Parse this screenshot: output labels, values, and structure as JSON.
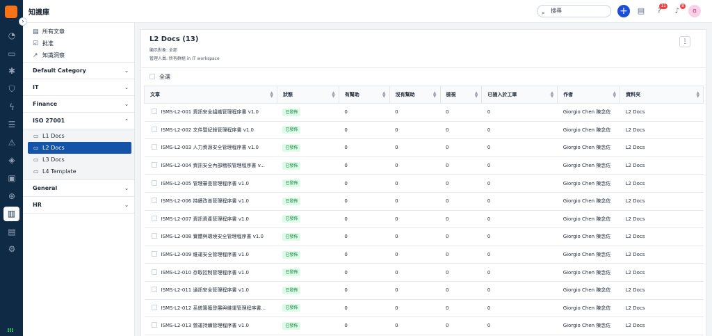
{
  "app": {
    "title": "知識庫"
  },
  "search": {
    "placeholder": "搜尋"
  },
  "header_badges": {
    "help": "11",
    "notifications": "8"
  },
  "avatar": {
    "initials": "G"
  },
  "rail": [
    {
      "name": "dashboard-icon",
      "glyph": "◔"
    },
    {
      "name": "inbox-icon",
      "glyph": "▭"
    },
    {
      "name": "bug-icon",
      "glyph": "✱"
    },
    {
      "name": "shield-icon",
      "glyph": "⛉"
    },
    {
      "name": "bolt-icon",
      "glyph": "ϟ"
    },
    {
      "name": "list-icon",
      "glyph": "☰"
    },
    {
      "name": "warning-icon",
      "glyph": "⚠"
    },
    {
      "name": "layers-icon",
      "glyph": "◈"
    },
    {
      "name": "contacts-icon",
      "glyph": "▣"
    },
    {
      "name": "compass-icon",
      "glyph": "⊕"
    },
    {
      "name": "book-icon",
      "glyph": "▥"
    },
    {
      "name": "chart-icon",
      "glyph": "▤"
    },
    {
      "name": "settings-icon",
      "glyph": "⚙"
    }
  ],
  "sidebar": {
    "links": [
      {
        "label": "所有文章",
        "icon": "▤"
      },
      {
        "label": "批准",
        "icon": "☑"
      },
      {
        "label": "知識洞察",
        "icon": "↗"
      }
    ],
    "categories": [
      {
        "label": "Default Category",
        "open": false,
        "children": []
      },
      {
        "label": "IT",
        "open": false,
        "children": []
      },
      {
        "label": "Finance",
        "open": false,
        "children": []
      },
      {
        "label": "ISO 27001",
        "open": true,
        "children": [
          {
            "label": "L1 Docs",
            "selected": false
          },
          {
            "label": "L2 Docs",
            "selected": true
          },
          {
            "label": "L3 Docs",
            "selected": false
          },
          {
            "label": "L4 Template",
            "selected": false
          }
        ]
      },
      {
        "label": "General",
        "open": false,
        "children": []
      },
      {
        "label": "HR",
        "open": false,
        "children": []
      }
    ]
  },
  "main": {
    "title": "L2 Docs (13)",
    "visibility": "顯示對象: 全部",
    "admin": "管理人員: 所有群組 in IT workspace",
    "select_all": "全選"
  },
  "table": {
    "columns": [
      "文章",
      "狀態",
      "有幫助",
      "沒有幫助",
      "檢視",
      "已插入於工單",
      "作者",
      "資料夾"
    ],
    "column_widths": [
      191,
      89,
      73,
      73,
      60,
      109,
      90,
      120
    ],
    "rows": [
      [
        "ISMS-L2-001 資訊安全組織管理程序書 v1.0",
        "已發佈",
        "0",
        "0",
        "0",
        "0",
        "Giorgio Chen 陳念佐",
        "L2 Docs"
      ],
      [
        "ISMS-L2-002 文件暨紀錄管理程序書 v1.0",
        "已發佈",
        "0",
        "0",
        "0",
        "0",
        "Giorgio Chen 陳念佐",
        "L2 Docs"
      ],
      [
        "ISMS-L2-003 人力資源安全管理程序書 v1.0",
        "已發佈",
        "0",
        "0",
        "0",
        "0",
        "Giorgio Chen 陳念佐",
        "L2 Docs"
      ],
      [
        "ISMS-L2-004 資訊安全內部稽核管理程序書 v...",
        "已發佈",
        "0",
        "0",
        "0",
        "0",
        "Giorgio Chen 陳念佐",
        "L2 Docs"
      ],
      [
        "ISMS-L2-005 管理審查管理程序書 v1.0",
        "已發佈",
        "0",
        "0",
        "0",
        "0",
        "Giorgio Chen 陳念佐",
        "L2 Docs"
      ],
      [
        "ISMS-L2-006 持續改善管理程序書 v1.0",
        "已發佈",
        "0",
        "0",
        "0",
        "0",
        "Giorgio Chen 陳念佐",
        "L2 Docs"
      ],
      [
        "ISMS-L2-007 資訊資產管理程序書 v1.0",
        "已發佈",
        "0",
        "0",
        "0",
        "0",
        "Giorgio Chen 陳念佐",
        "L2 Docs"
      ],
      [
        "ISMS-L2-008 實體與環境安全管理程序書 v1.0",
        "已發佈",
        "0",
        "0",
        "0",
        "0",
        "Giorgio Chen 陳念佐",
        "L2 Docs"
      ],
      [
        "ISMS-L2-009 維運安全管理程序書 v1.0",
        "已發佈",
        "0",
        "0",
        "0",
        "0",
        "Giorgio Chen 陳念佐",
        "L2 Docs"
      ],
      [
        "ISMS-L2-010 存取控制管理程序書 v1.0",
        "已發佈",
        "0",
        "0",
        "0",
        "0",
        "Giorgio Chen 陳念佐",
        "L2 Docs"
      ],
      [
        "ISMS-L2-011 通訊安全管理程序書 v1.0",
        "已發佈",
        "0",
        "0",
        "0",
        "0",
        "Giorgio Chen 陳念佐",
        "L2 Docs"
      ],
      [
        "ISMS-L2-012 系統籌獲發展與維運管理程序書...",
        "已發佈",
        "0",
        "0",
        "0",
        "0",
        "Giorgio Chen 陳念佐",
        "L2 Docs"
      ],
      [
        "ISMS-L2-013 營運持續管理程序書 v1.0",
        "已發佈",
        "0",
        "0",
        "0",
        "0",
        "Giorgio Chen 陳念佐",
        "L2 Docs"
      ]
    ]
  }
}
